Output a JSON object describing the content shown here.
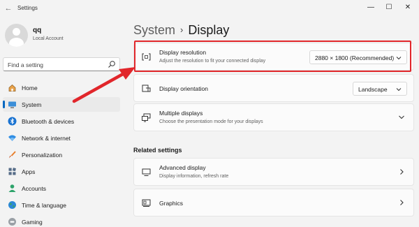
{
  "window": {
    "title": "Settings",
    "back_glyph": "←",
    "min_glyph": "—",
    "max_glyph": "☐",
    "close_glyph": "✕"
  },
  "user": {
    "name": "qq",
    "account_type": "Local Account"
  },
  "search": {
    "placeholder": "Find a setting"
  },
  "nav": {
    "items": [
      {
        "label": "Home",
        "icon": "home-icon"
      },
      {
        "label": "System",
        "icon": "system-icon",
        "active": true
      },
      {
        "label": "Bluetooth & devices",
        "icon": "bluetooth-icon"
      },
      {
        "label": "Network & internet",
        "icon": "wifi-icon"
      },
      {
        "label": "Personalization",
        "icon": "brush-icon"
      },
      {
        "label": "Apps",
        "icon": "apps-icon"
      },
      {
        "label": "Accounts",
        "icon": "person-icon"
      },
      {
        "label": "Time & language",
        "icon": "globe-icon"
      },
      {
        "label": "Gaming",
        "icon": "gaming-icon"
      }
    ]
  },
  "page": {
    "breadcrumb_parent": "System",
    "breadcrumb_sep": "›",
    "title": "Display"
  },
  "cards": {
    "resolution": {
      "title": "Display resolution",
      "subtitle": "Adjust the resolution to fit your connected display",
      "value": "2880 × 1800 (Recommended)"
    },
    "orientation": {
      "title": "Display orientation",
      "value": "Landscape"
    },
    "multiple": {
      "title": "Multiple displays",
      "subtitle": "Choose the presentation mode for your displays"
    }
  },
  "related": {
    "heading": "Related settings",
    "advanced": {
      "title": "Advanced display",
      "subtitle": "Display information, refresh rate"
    },
    "graphics": {
      "title": "Graphics"
    }
  },
  "colors": {
    "accent": "#0067c0",
    "highlight": "#e1262b",
    "background": "#f3f3f3",
    "card": "#fbfbfb"
  }
}
